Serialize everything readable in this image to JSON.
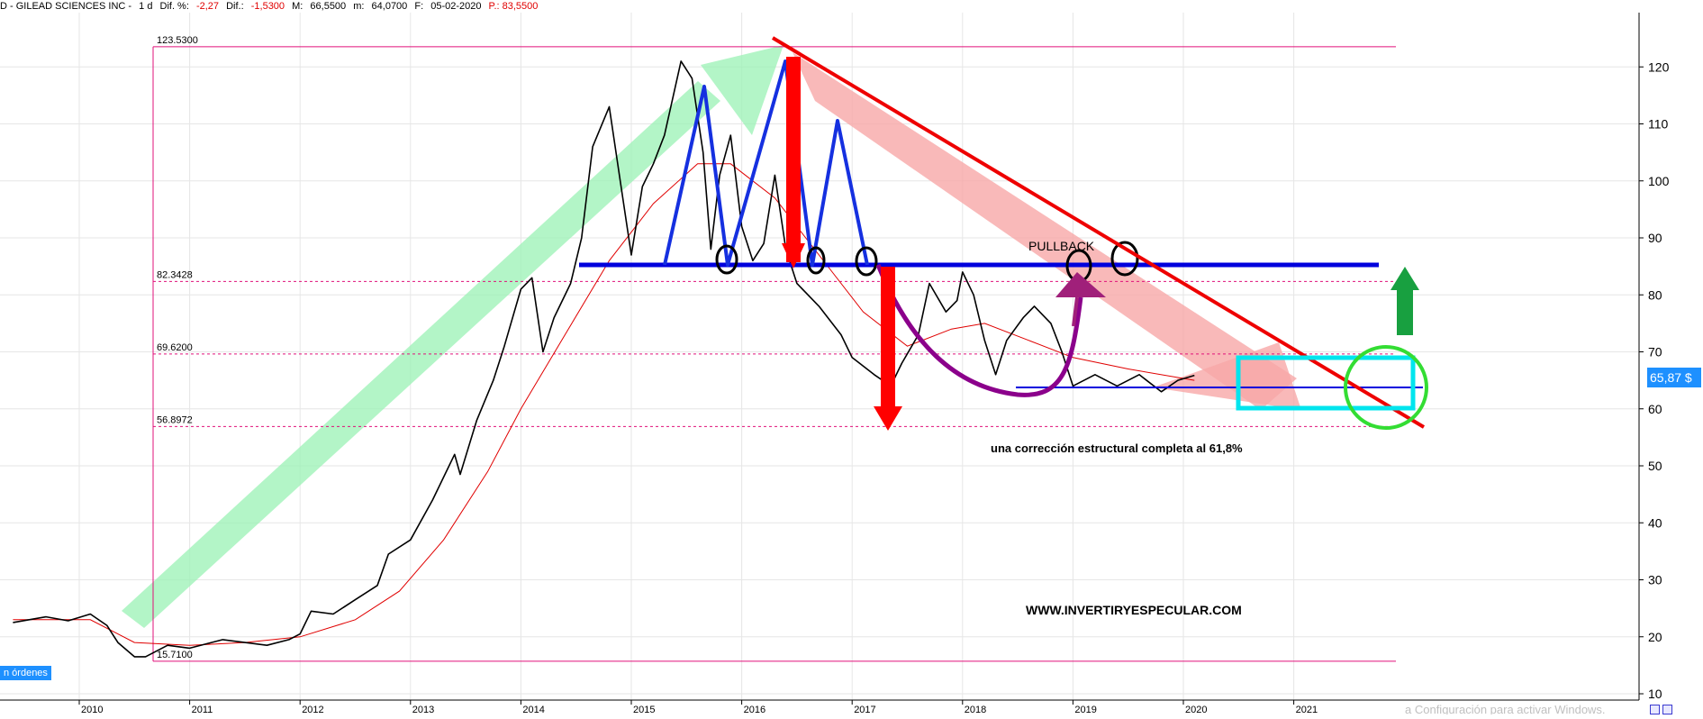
{
  "header": {
    "title": "D - GILEAD SCIENCES INC -",
    "interval": "1 d",
    "dif_pct_label": "Dif. %:",
    "dif_pct": "-2,27",
    "dif_label": "Dif.:",
    "dif": "-1,5300",
    "max_label": "M:",
    "max": "66,5500",
    "min_label": "m:",
    "min": "64,0700",
    "date_label": "F:",
    "date": "05-02-2020",
    "price": "P.: 83,5500"
  },
  "last_price_tag": "65,87 $",
  "orders_tag": "n órdenes",
  "watermark": "a Configuración para activar Windows.",
  "colors": {
    "price": "#000000",
    "moving_average": "#e00000",
    "support_line": "#0000dd",
    "trendline": "#ee0000",
    "fib_lines": "#e0107a",
    "pattern": "#1530e0",
    "curve": "#8b008b",
    "box": "#00e5ee",
    "circle": "#33dd33",
    "up_arrow": "#18a040",
    "bull_band": "#9af2b4",
    "bear_band": "#f7a8a8",
    "down_arrows": "#ff0000",
    "label_blue": "#1e90ff"
  },
  "chart_data": {
    "type": "line",
    "title": "GILEAD SCIENCES INC",
    "x_ticks": [
      "2010",
      "2011",
      "2012",
      "2013",
      "2014",
      "2015",
      "2016",
      "2017",
      "2018",
      "2019",
      "2020",
      "2021"
    ],
    "x_range": [
      2009.4,
      2021.9
    ],
    "ylim": [
      10,
      125
    ],
    "y_ticks": [
      10,
      20,
      30,
      40,
      50,
      60,
      70,
      80,
      90,
      100,
      110,
      120
    ],
    "grid": true,
    "fib_levels": [
      {
        "label": "123.5300",
        "value": 123.53
      },
      {
        "label": "82.3428",
        "value": 82.3428
      },
      {
        "label": "69.6200",
        "value": 69.62
      },
      {
        "label": "56.8972",
        "value": 56.8972
      },
      {
        "label": "15.7100",
        "value": 15.71
      }
    ],
    "price_series": [
      {
        "x": 2009.4,
        "y": 22.5
      },
      {
        "x": 2009.7,
        "y": 23.5
      },
      {
        "x": 2009.9,
        "y": 22.8
      },
      {
        "x": 2010.1,
        "y": 24.0
      },
      {
        "x": 2010.25,
        "y": 22.0
      },
      {
        "x": 2010.35,
        "y": 19.0
      },
      {
        "x": 2010.5,
        "y": 16.5
      },
      {
        "x": 2010.6,
        "y": 16.5
      },
      {
        "x": 2010.8,
        "y": 18.5
      },
      {
        "x": 2011.0,
        "y": 18.0
      },
      {
        "x": 2011.3,
        "y": 19.5
      },
      {
        "x": 2011.5,
        "y": 19.0
      },
      {
        "x": 2011.7,
        "y": 18.5
      },
      {
        "x": 2011.9,
        "y": 19.5
      },
      {
        "x": 2012.0,
        "y": 20.5
      },
      {
        "x": 2012.1,
        "y": 24.5
      },
      {
        "x": 2012.3,
        "y": 24.0
      },
      {
        "x": 2012.5,
        "y": 26.5
      },
      {
        "x": 2012.7,
        "y": 29.0
      },
      {
        "x": 2012.8,
        "y": 34.5
      },
      {
        "x": 2013.0,
        "y": 37.0
      },
      {
        "x": 2013.2,
        "y": 44.0
      },
      {
        "x": 2013.4,
        "y": 52.0
      },
      {
        "x": 2013.45,
        "y": 48.5
      },
      {
        "x": 2013.6,
        "y": 58.0
      },
      {
        "x": 2013.75,
        "y": 65.0
      },
      {
        "x": 2013.85,
        "y": 71.0
      },
      {
        "x": 2014.0,
        "y": 81.0
      },
      {
        "x": 2014.1,
        "y": 83.0
      },
      {
        "x": 2014.2,
        "y": 70.0
      },
      {
        "x": 2014.3,
        "y": 76.0
      },
      {
        "x": 2014.45,
        "y": 82.0
      },
      {
        "x": 2014.55,
        "y": 90.0
      },
      {
        "x": 2014.65,
        "y": 106.0
      },
      {
        "x": 2014.8,
        "y": 113.0
      },
      {
        "x": 2014.9,
        "y": 100.0
      },
      {
        "x": 2015.0,
        "y": 87.0
      },
      {
        "x": 2015.1,
        "y": 99.0
      },
      {
        "x": 2015.2,
        "y": 103.0
      },
      {
        "x": 2015.3,
        "y": 108.0
      },
      {
        "x": 2015.45,
        "y": 121.0
      },
      {
        "x": 2015.55,
        "y": 118.0
      },
      {
        "x": 2015.65,
        "y": 105.0
      },
      {
        "x": 2015.72,
        "y": 88.0
      },
      {
        "x": 2015.8,
        "y": 101.0
      },
      {
        "x": 2015.9,
        "y": 108.0
      },
      {
        "x": 2016.0,
        "y": 92.0
      },
      {
        "x": 2016.1,
        "y": 86.0
      },
      {
        "x": 2016.2,
        "y": 89.0
      },
      {
        "x": 2016.3,
        "y": 101.0
      },
      {
        "x": 2016.4,
        "y": 88.0
      },
      {
        "x": 2016.5,
        "y": 82.0
      },
      {
        "x": 2016.7,
        "y": 78.0
      },
      {
        "x": 2016.9,
        "y": 73.0
      },
      {
        "x": 2017.0,
        "y": 69.0
      },
      {
        "x": 2017.2,
        "y": 66.0
      },
      {
        "x": 2017.35,
        "y": 64.0
      },
      {
        "x": 2017.45,
        "y": 68.0
      },
      {
        "x": 2017.6,
        "y": 73.0
      },
      {
        "x": 2017.7,
        "y": 82.0
      },
      {
        "x": 2017.85,
        "y": 77.0
      },
      {
        "x": 2017.95,
        "y": 79.0
      },
      {
        "x": 2018.0,
        "y": 84.0
      },
      {
        "x": 2018.1,
        "y": 80.0
      },
      {
        "x": 2018.2,
        "y": 72.0
      },
      {
        "x": 2018.3,
        "y": 66.0
      },
      {
        "x": 2018.4,
        "y": 72.0
      },
      {
        "x": 2018.55,
        "y": 76.0
      },
      {
        "x": 2018.65,
        "y": 78.0
      },
      {
        "x": 2018.8,
        "y": 75.0
      },
      {
        "x": 2018.9,
        "y": 70.0
      },
      {
        "x": 2019.0,
        "y": 64.0
      },
      {
        "x": 2019.2,
        "y": 66.0
      },
      {
        "x": 2019.4,
        "y": 64.0
      },
      {
        "x": 2019.6,
        "y": 66.0
      },
      {
        "x": 2019.8,
        "y": 63.0
      },
      {
        "x": 2019.95,
        "y": 65.0
      },
      {
        "x": 2020.1,
        "y": 65.87
      }
    ],
    "moving_average": [
      {
        "x": 2009.4,
        "y": 23.0
      },
      {
        "x": 2010.1,
        "y": 23.0
      },
      {
        "x": 2010.5,
        "y": 19.0
      },
      {
        "x": 2011.0,
        "y": 18.5
      },
      {
        "x": 2011.5,
        "y": 19.0
      },
      {
        "x": 2012.0,
        "y": 20.0
      },
      {
        "x": 2012.5,
        "y": 23.0
      },
      {
        "x": 2012.9,
        "y": 28.0
      },
      {
        "x": 2013.3,
        "y": 37.0
      },
      {
        "x": 2013.7,
        "y": 49.0
      },
      {
        "x": 2014.0,
        "y": 60.0
      },
      {
        "x": 2014.4,
        "y": 73.0
      },
      {
        "x": 2014.8,
        "y": 86.0
      },
      {
        "x": 2015.2,
        "y": 96.0
      },
      {
        "x": 2015.6,
        "y": 103.0
      },
      {
        "x": 2015.9,
        "y": 103.0
      },
      {
        "x": 2016.3,
        "y": 97.0
      },
      {
        "x": 2016.7,
        "y": 87.0
      },
      {
        "x": 2017.1,
        "y": 77.0
      },
      {
        "x": 2017.5,
        "y": 71.0
      },
      {
        "x": 2017.9,
        "y": 74.0
      },
      {
        "x": 2018.2,
        "y": 75.0
      },
      {
        "x": 2018.6,
        "y": 72.0
      },
      {
        "x": 2019.0,
        "y": 69.0
      },
      {
        "x": 2019.5,
        "y": 67.0
      },
      {
        "x": 2020.1,
        "y": 65.0
      }
    ],
    "support_level": 85,
    "annotations": {
      "pullback": "PULLBACK",
      "correction_note": "una corrección estructural completa al 61,8%",
      "website": "WWW.INVERTIRYESPECULAR.COM"
    }
  }
}
